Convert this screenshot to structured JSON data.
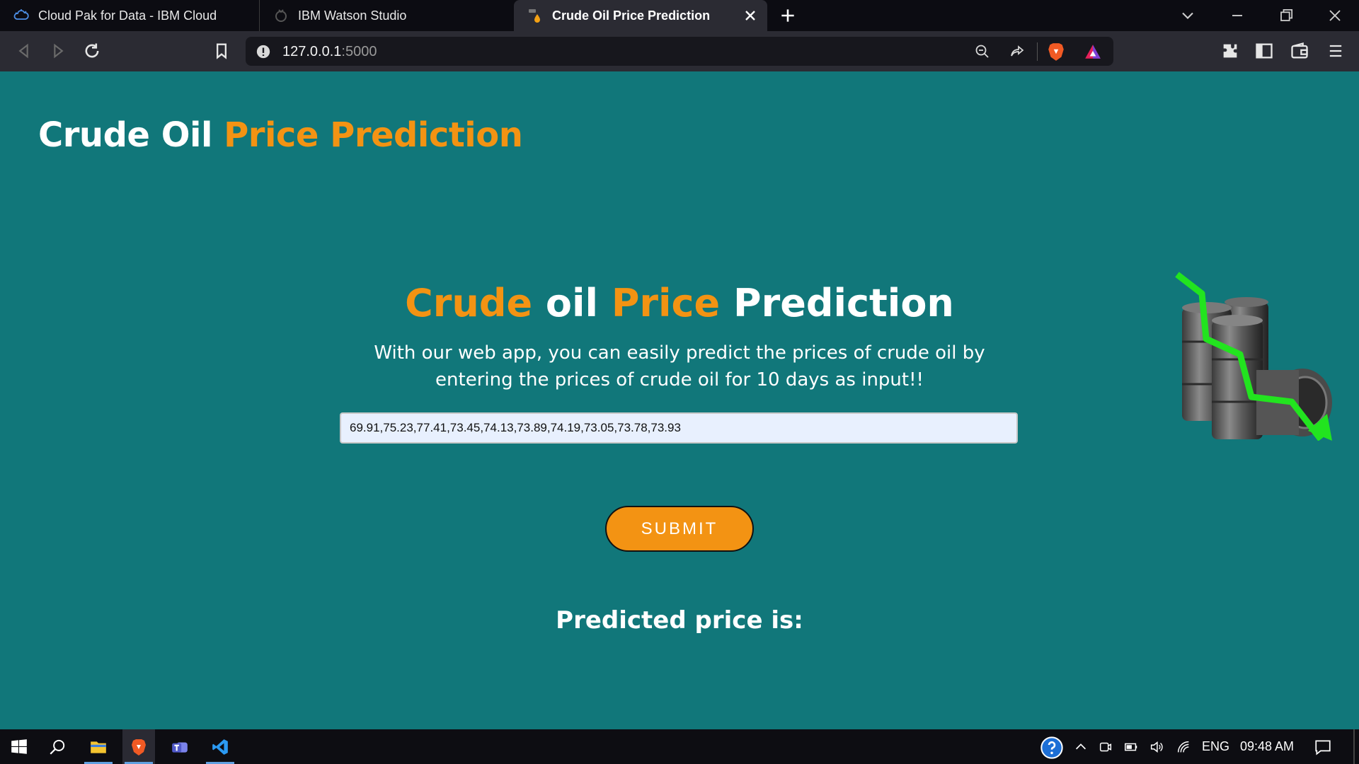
{
  "browser": {
    "tabs": [
      {
        "title": "Cloud Pak for Data - IBM Cloud",
        "icon": "cloud-icon"
      },
      {
        "title": "IBM Watson Studio",
        "icon": "watson-icon"
      },
      {
        "title": "Crude Oil Price Prediction",
        "icon": "oil-drop-icon",
        "active": true
      }
    ],
    "url_host": "127.0.0.1",
    "url_port": ":5000"
  },
  "page": {
    "brand": {
      "part1": "Crude Oil ",
      "part2": "Price Prediction"
    },
    "hero_title": {
      "w1": "Crude",
      "w2": " oil ",
      "w3": "Price",
      "w4": " Prediction"
    },
    "description": "With our web app, you can easily predict the prices of crude oil by entering the prices of crude oil for 10 days as input!!",
    "input_value": "69.91,75.23,77.41,73.45,74.13,73.89,74.19,73.05,73.78,73.93",
    "submit_label": "SUBMIT",
    "result_label": "Predicted price is:"
  },
  "taskbar": {
    "language": "ENG",
    "time": "09:48 AM"
  },
  "colors": {
    "page_bg": "#11777a",
    "accent_orange": "#f39313",
    "arrow_green": "#22e41f"
  }
}
